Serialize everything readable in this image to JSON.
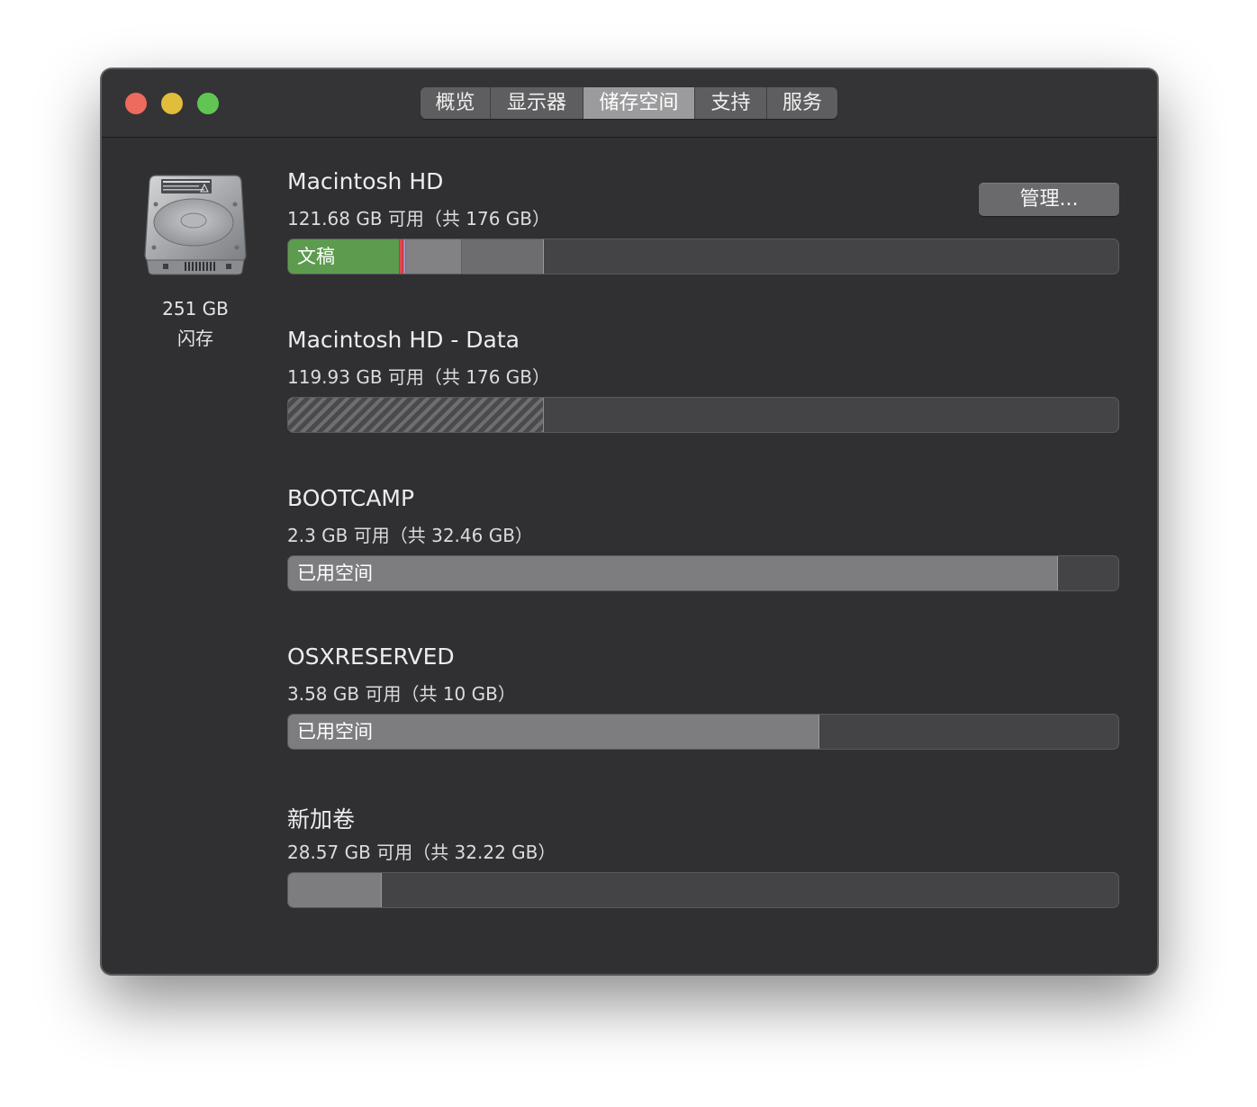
{
  "tabs": [
    {
      "label": "概览"
    },
    {
      "label": "显示器"
    },
    {
      "label": "储存空间",
      "selected": true
    },
    {
      "label": "支持"
    },
    {
      "label": "服务"
    }
  ],
  "disk": {
    "icon": "hard-drive-icon",
    "size": "251 GB",
    "type": "闪存"
  },
  "manage_button": "管理...",
  "volumes": [
    {
      "name": "Macintosh HD",
      "capacity": "121.68 GB 可用（共 176 GB）",
      "usage": [
        {
          "label": "文稿",
          "percent": 13.5,
          "color": "#5d9c4f"
        },
        {
          "percent": 0.4,
          "color": "#e0474c"
        },
        {
          "percent": 0.3,
          "color": "#a78fc0"
        },
        {
          "percent": 6.7,
          "color": "#828284"
        },
        {
          "percent": 9.9,
          "color": "#6d6d6f"
        }
      ]
    },
    {
      "name": "Macintosh HD - Data",
      "capacity": "119.93 GB 可用（共 176 GB）",
      "usage": [
        {
          "percent": 30.8,
          "pattern": "hatched"
        }
      ]
    },
    {
      "name": "BOOTCAMP",
      "capacity": "2.3 GB 可用（共 32.46 GB）",
      "usage": [
        {
          "label": "已用空间",
          "percent": 92.7,
          "color": "#7d7d7f"
        }
      ]
    },
    {
      "name": "OSXRESERVED",
      "capacity": "3.58 GB 可用（共 10 GB）",
      "usage": [
        {
          "label": "已用空间",
          "percent": 64.0,
          "color": "#7d7d7f"
        }
      ]
    },
    {
      "name": "新加卷",
      "capacity": "28.57 GB 可用（共 32.22 GB）",
      "usage": [
        {
          "percent": 11.3,
          "color": "#7d7d7f"
        }
      ]
    }
  ]
}
